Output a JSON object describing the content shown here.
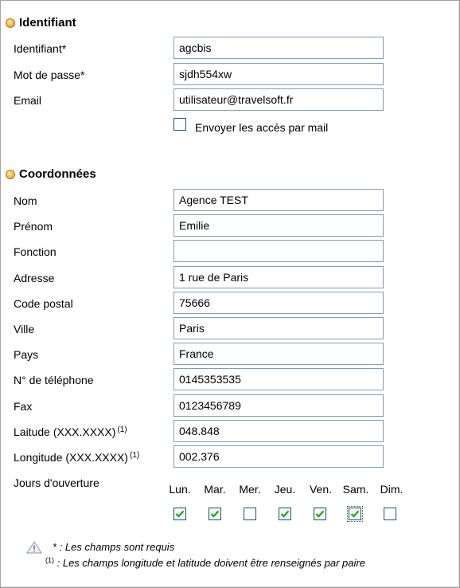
{
  "identifiant_section": {
    "title": "Identifiant",
    "identifiant_label": "Identifiant*",
    "identifiant_value": "agcbis",
    "password_label": "Mot de passe*",
    "password_value": "sjdh554xw",
    "email_label": "Email",
    "email_value": "utilisateur@travelsoft.fr",
    "send_access_label": "Envoyer les accès par mail",
    "send_access_checked": false
  },
  "coordonnees_section": {
    "title": "Coordonnées",
    "nom_label": "Nom",
    "nom_value": "Agence TEST",
    "prenom_label": "Prénom",
    "prenom_value": "Emilie",
    "fonction_label": "Fonction",
    "fonction_value": "",
    "adresse_label": "Adresse",
    "adresse_value": "1 rue de Paris",
    "code_postal_label": "Code postal",
    "code_postal_value": "75666",
    "ville_label": "Ville",
    "ville_value": "Paris",
    "pays_label": "Pays",
    "pays_value": "France",
    "telephone_label": "N° de téléphone",
    "telephone_value": "0145353535",
    "fax_label": "Fax",
    "fax_value": "0123456789",
    "latitude_label": "Laitude (XXX.XXXX)",
    "latitude_note_marker": "(1)",
    "latitude_value": "048.848",
    "longitude_label": "Longitude (XXX.XXXX)",
    "longitude_note_marker": "(1)",
    "longitude_value": "002.376",
    "opening_days_label": "Jours d'ouverture",
    "days": [
      {
        "label": "Lun.",
        "checked": true
      },
      {
        "label": "Mar.",
        "checked": true
      },
      {
        "label": "Mer.",
        "checked": false
      },
      {
        "label": "Jeu.",
        "checked": true
      },
      {
        "label": "Ven.",
        "checked": true
      },
      {
        "label": "Sam.",
        "checked": true
      },
      {
        "label": "Dim.",
        "checked": false
      }
    ]
  },
  "notes": {
    "required_text": "* : Les champs sont requis",
    "pair_marker": "(1)",
    "pair_text": " : Les champs longitude et latitude doivent être renseignés par paire"
  },
  "colors": {
    "field_border": "#7f9db9",
    "checkbox_border": "#1c5180",
    "check_mark": "#21a121",
    "bullet": "#f3b94a"
  }
}
